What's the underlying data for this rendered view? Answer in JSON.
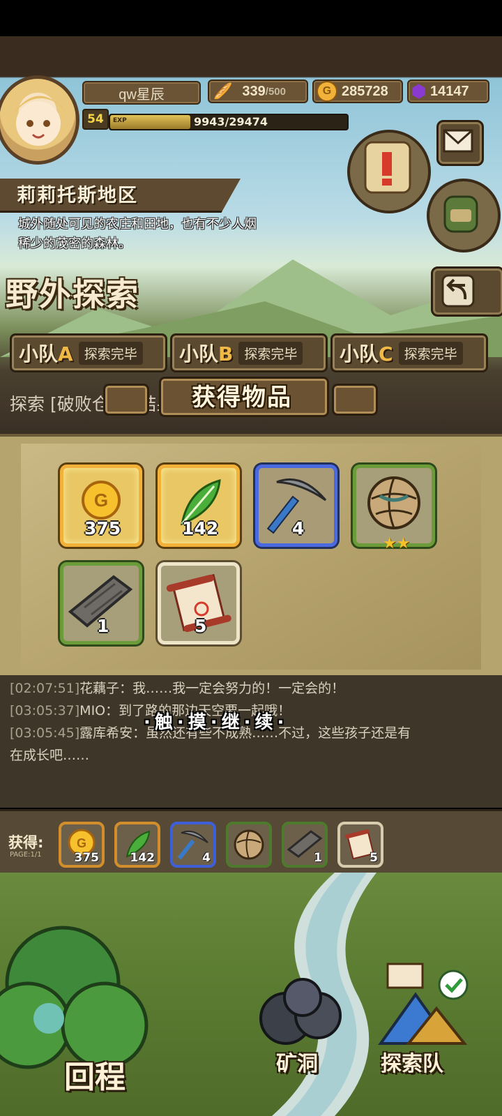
{
  "player": {
    "name": "qw星辰",
    "level": "54",
    "exp_label": "EXP",
    "exp_text": "9943/29474",
    "exp_fraction": 0.337
  },
  "resources": {
    "stamina": "339",
    "stamina_max": "/500",
    "gold": "285728",
    "gems": "14147"
  },
  "region": {
    "name": "莉莉托斯地区",
    "description": "城外随处可见的农庄和田地，也有不少人烟稀少的茂密的森林。"
  },
  "page_title": "野外探索",
  "teams": [
    {
      "prefix": "小队",
      "letter": "A",
      "status": "探索完毕"
    },
    {
      "prefix": "小队",
      "letter": "B",
      "status": "探索完毕"
    },
    {
      "prefix": "小队",
      "letter": "C",
      "status": "探索完毕"
    }
  ],
  "explore_line": "探索 [破败仓库] 结果:",
  "obtain_title": "获得物品",
  "rewards": [
    {
      "icon": "gold-coin-icon",
      "quantity": "375",
      "rarity": "gold"
    },
    {
      "icon": "green-feather-icon",
      "quantity": "142",
      "rarity": "gold"
    },
    {
      "icon": "pickaxe-icon",
      "quantity": "4",
      "rarity": "blue"
    },
    {
      "icon": "wicker-ball-icon",
      "quantity": "",
      "rarity": "green",
      "stars": "★★"
    },
    {
      "icon": "wood-plank-icon",
      "quantity": "1",
      "rarity": "green"
    },
    {
      "icon": "treasure-map-scroll-icon",
      "quantity": "5",
      "rarity": "white"
    }
  ],
  "log": [
    {
      "time": "[02:07:51]",
      "text": "花藕子：我……我一定会努力的！一定会的！"
    },
    {
      "time": "[03:05:37]",
      "text": "MIO：到了路的那边天空要一起哦！"
    },
    {
      "time": "[03:05:45]",
      "text": "露库希安：虽然还有些不成熟……不过，这些孩子还是有"
    },
    {
      "time": "",
      "text": "在成长吧……"
    }
  ],
  "continue_hint": "·触·摸·继·续·",
  "obtained_bar": {
    "label": "获得:",
    "page": "PAGE:1/1",
    "items": [
      {
        "icon": "gold-coin-icon",
        "quantity": "375",
        "rarity": "gold"
      },
      {
        "icon": "green-feather-icon",
        "quantity": "142",
        "rarity": "gold"
      },
      {
        "icon": "pickaxe-icon",
        "quantity": "4",
        "rarity": "blue"
      },
      {
        "icon": "wicker-ball-icon",
        "quantity": "",
        "rarity": "green"
      },
      {
        "icon": "wood-plank-icon",
        "quantity": "1",
        "rarity": "green"
      },
      {
        "icon": "treasure-map-scroll-icon",
        "quantity": "5",
        "rarity": "white"
      }
    ]
  },
  "bottom_nav": {
    "return": "回程",
    "mine": "矿洞",
    "explore_team": "探索队"
  },
  "colors": {
    "gold_border": "#f2b23a",
    "blue_border": "#4c6ae0",
    "green_border": "#6c9c3a",
    "panel_bg": "#b5a46e"
  }
}
